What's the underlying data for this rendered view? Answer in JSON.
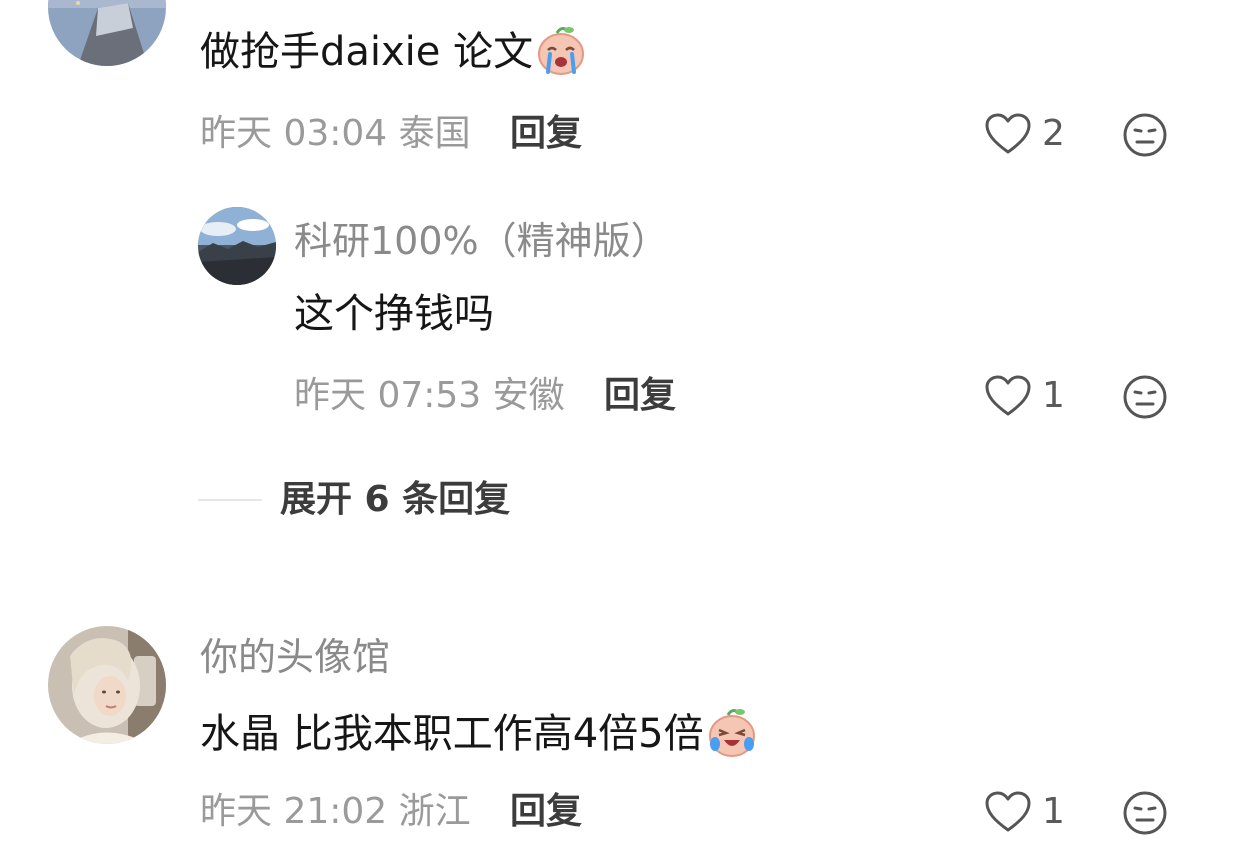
{
  "comments": [
    {
      "username": "",
      "text": "做抢手daixie 论文",
      "emoji": "crying-face-emoji",
      "time": "昨天 03:04",
      "location": "泰国",
      "reply_label": "回复",
      "likes": "2",
      "replies": [
        {
          "username": "科研100%（精神版）",
          "text": "这个挣钱吗",
          "time": "昨天 07:53",
          "location": "安徽",
          "reply_label": "回复",
          "likes": "1"
        }
      ],
      "expand_label": "展开 6 条回复"
    },
    {
      "username": "你的头像馆",
      "text": "水晶 比我本职工作高4倍5倍",
      "emoji": "laughing-crying-face-emoji",
      "time": "昨天 21:02",
      "location": "浙江",
      "reply_label": "回复",
      "likes": "1"
    }
  ],
  "colors": {
    "text_primary": "#161616",
    "text_secondary": "#9a9a9a",
    "username": "#8a8a8a",
    "reply": "#3c3c3c",
    "divider": "#e6e6e6"
  }
}
